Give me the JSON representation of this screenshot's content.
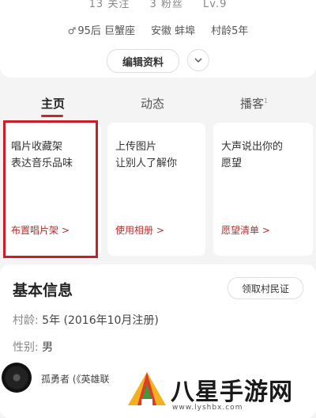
{
  "profile": {
    "stats": [
      "13 关注",
      "3 粉丝",
      "Lv.9"
    ],
    "info": {
      "gender_age": "95后 巨蟹座",
      "location": "安徽 蚌埠",
      "village_age": "村龄5年"
    },
    "edit_label": "编辑资料"
  },
  "tabs": [
    {
      "label": "主页",
      "active": true
    },
    {
      "label": "动态",
      "active": false
    },
    {
      "label": "播客",
      "badge": "1",
      "active": false
    }
  ],
  "cards": [
    {
      "title": "唱片收藏架\n表达音乐品味",
      "link": "布置唱片架 >"
    },
    {
      "title": "上传图片\n让别人了解你",
      "link": "使用相册 >"
    },
    {
      "title": "大声说出你的\n愿望",
      "link": "愿望清单 >"
    }
  ],
  "basic_info": {
    "title": "基本信息",
    "village_cert_button": "领取村民证",
    "village_age_label": "村龄:",
    "village_age_value": "5年 (2016年10月注册)",
    "gender_label": "性别:",
    "gender_value": "男"
  },
  "player": {
    "song": "孤勇者 (《英雄联"
  },
  "watermark": {
    "text": "八星手游网",
    "url": "www.lyshbx.com"
  },
  "colors": {
    "accent": "#c8262a",
    "link": "#b5302f",
    "background": "#f4f4f4"
  }
}
